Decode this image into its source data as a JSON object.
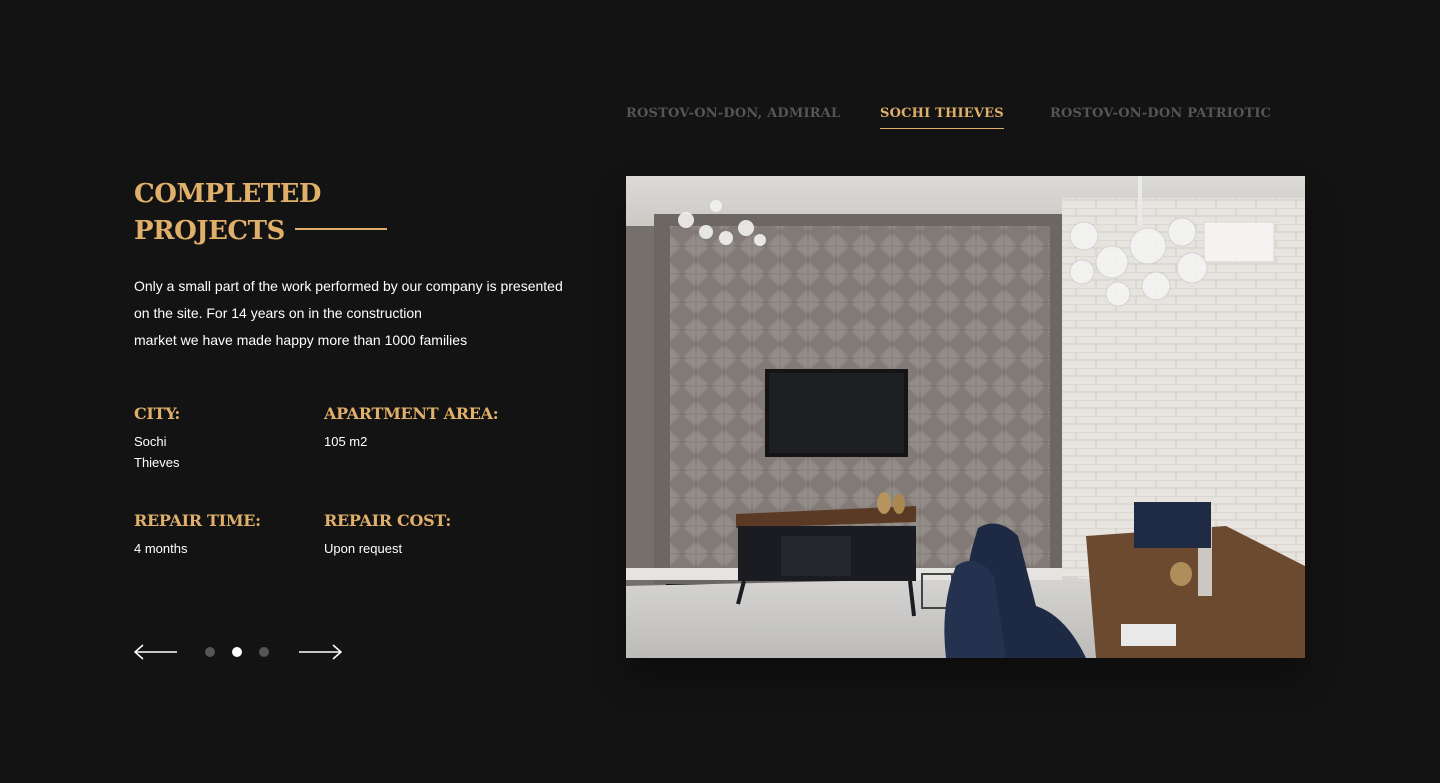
{
  "tabs": [
    {
      "label": "ROSTOV-ON-DON, ADMIRAL",
      "active": false
    },
    {
      "label": "SOCHI THIEVES",
      "active": true
    },
    {
      "label": "ROSTOV-ON-DON PATRIOTIC",
      "active": false
    }
  ],
  "heading": {
    "line1": "COMPLETED",
    "line2": "PROJECTS"
  },
  "description": {
    "line1": "Only a small part of the work performed by our company is presented",
    "line2": "on the site. For 14 years on in the construction",
    "line3": "market we have made happy more than 1000 families"
  },
  "details": {
    "city": {
      "label": "CITY:",
      "value_line1": "Sochi",
      "value_line2": "Thieves"
    },
    "area": {
      "label": "APARTMENT AREA:",
      "value": "105 m2"
    },
    "time": {
      "label": "REPAIR TIME:",
      "value": "4 months"
    },
    "cost": {
      "label": "REPAIR COST:",
      "value": "Upon request"
    }
  },
  "pager": {
    "slide_count": 3,
    "active_slide": 2,
    "prev_icon": "arrow-left-icon",
    "next_icon": "arrow-right-icon"
  },
  "colors": {
    "background": "#131313",
    "accent": "#e0b06a",
    "inactive_tab": "#555555",
    "text": "#ffffff"
  }
}
